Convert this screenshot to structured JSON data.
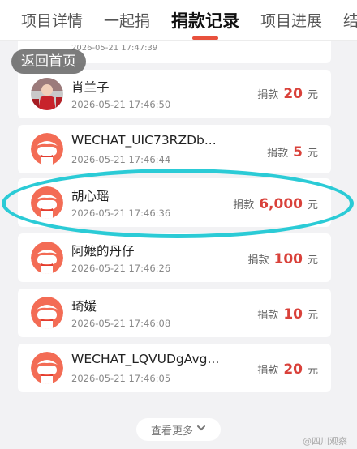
{
  "tabs": [
    "项目详情",
    "一起捐",
    "捐款记录",
    "项目进展",
    "结项"
  ],
  "active_tab": 2,
  "back_label": "返回首页",
  "partial_time": "2026-05-21 17:47:39",
  "donations": [
    {
      "name": "肖兰子",
      "time": "2026-05-21 17:46:50",
      "prefix": "捐款",
      "amount": "20",
      "unit": "元",
      "avatar": "photo-avatar"
    },
    {
      "name": "WECHAT_UIC73RZDb...",
      "time": "2026-05-21 17:46:44",
      "prefix": "捐款",
      "amount": "5",
      "unit": "元",
      "avatar": "default-avatar"
    },
    {
      "name": "胡心瑶",
      "time": "2026-05-21 17:46:36",
      "prefix": "捐款",
      "amount": "6,000",
      "unit": "元",
      "avatar": "default-avatar"
    },
    {
      "name": "阿嬷的丹仔",
      "time": "2026-05-21 17:46:26",
      "prefix": "捐款",
      "amount": "100",
      "unit": "元",
      "avatar": "default-avatar"
    },
    {
      "name": "琦媛",
      "time": "2026-05-21 17:46:08",
      "prefix": "捐款",
      "amount": "10",
      "unit": "元",
      "avatar": "default-avatar"
    },
    {
      "name": "WECHAT_LQVUDgAvg...",
      "time": "2026-05-21 17:46:05",
      "prefix": "捐款",
      "amount": "20",
      "unit": "元",
      "avatar": "default-avatar"
    }
  ],
  "more_label": "查看更多",
  "watermark": "@四川观察",
  "colors": {
    "accent": "#e8513d",
    "amount": "#d9413a",
    "highlight": "#2bcbd6"
  }
}
